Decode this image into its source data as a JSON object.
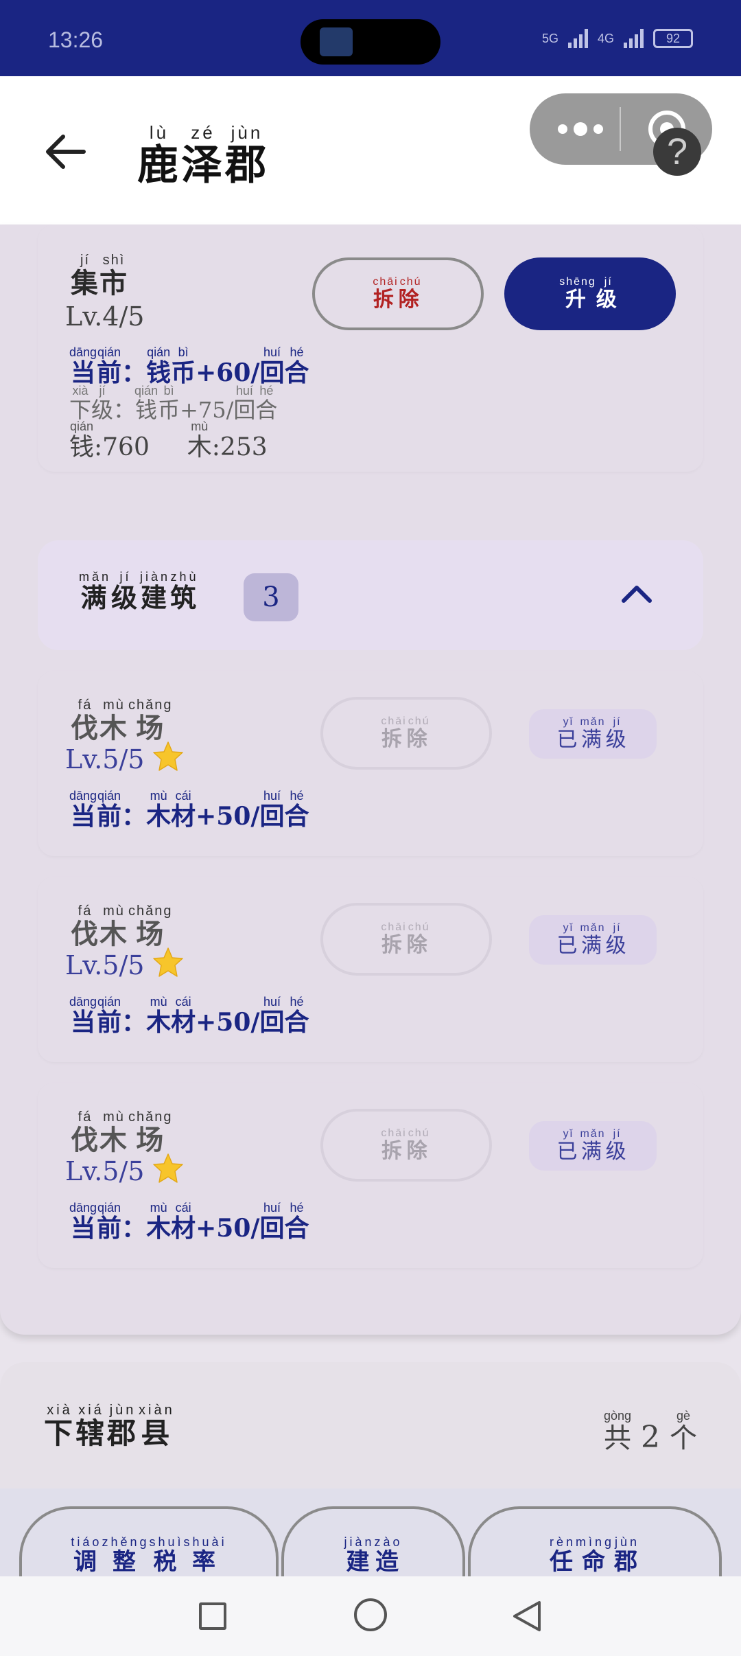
{
  "status": {
    "time": "13:26",
    "net1": "5G",
    "net2": "4G",
    "battery": "92"
  },
  "header": {
    "title": [
      {
        "ch": "鹿",
        "py": "lù"
      },
      {
        "ch": "泽",
        "py": "zé"
      },
      {
        "ch": "郡",
        "py": "jùn"
      }
    ],
    "help": "?"
  },
  "market": {
    "name": [
      {
        "ch": "集",
        "py": "jí"
      },
      {
        "ch": "市",
        "py": "shì"
      }
    ],
    "level": "Lv.4/5",
    "demolish": [
      {
        "ch": "拆",
        "py": "chāi"
      },
      {
        "ch": "除",
        "py": "chú"
      }
    ],
    "upgrade": [
      {
        "ch": "升",
        "py": "shēng"
      },
      {
        "ch": "级",
        "py": "jí"
      }
    ],
    "current": {
      "label": [
        {
          "ch": "当",
          "py": "dāng"
        },
        {
          "ch": "前",
          "py": "qián"
        }
      ],
      "colon": "：",
      "res": [
        {
          "ch": "钱",
          "py": "qián"
        },
        {
          "ch": "币",
          "py": "bì"
        }
      ],
      "amount": "+60/",
      "unit": [
        {
          "ch": "回",
          "py": "huí"
        },
        {
          "ch": "合",
          "py": "hé"
        }
      ]
    },
    "next": {
      "label": [
        {
          "ch": "下",
          "py": "xià"
        },
        {
          "ch": "级",
          "py": "jí"
        }
      ],
      "colon": "：",
      "res": [
        {
          "ch": "钱",
          "py": "qián"
        },
        {
          "ch": "币",
          "py": "bì"
        }
      ],
      "amount": "+75/",
      "unit": [
        {
          "ch": "回",
          "py": "huí"
        },
        {
          "ch": "合",
          "py": "hé"
        }
      ]
    },
    "cost": {
      "money_ch": "钱",
      "money_py": "qián",
      "money_val": ":760",
      "wood_ch": "木",
      "wood_py": "mù",
      "wood_val": ":253"
    }
  },
  "maxed_section": {
    "title": [
      {
        "ch": "满",
        "py": "mǎn"
      },
      {
        "ch": "级",
        "py": "jí"
      },
      {
        "ch": "建",
        "py": "jiàn"
      },
      {
        "ch": "筑",
        "py": "zhù"
      }
    ],
    "count": "3",
    "buildings": [
      {
        "name": [
          {
            "ch": "伐",
            "py": "fá"
          },
          {
            "ch": "木",
            "py": "mù"
          },
          {
            "ch": "场",
            "py": "chǎng"
          }
        ],
        "level": "Lv.5/5",
        "current": {
          "label": [
            {
              "ch": "当",
              "py": "dāng"
            },
            {
              "ch": "前",
              "py": "qián"
            }
          ],
          "colon": "：",
          "res": [
            {
              "ch": "木",
              "py": "mù"
            },
            {
              "ch": "材",
              "py": "cái"
            }
          ],
          "amount": "+50/",
          "unit": [
            {
              "ch": "回",
              "py": "huí"
            },
            {
              "ch": "合",
              "py": "hé"
            }
          ]
        }
      },
      {
        "name": [
          {
            "ch": "伐",
            "py": "fá"
          },
          {
            "ch": "木",
            "py": "mù"
          },
          {
            "ch": "场",
            "py": "chǎng"
          }
        ],
        "level": "Lv.5/5",
        "current": {
          "label": [
            {
              "ch": "当",
              "py": "dāng"
            },
            {
              "ch": "前",
              "py": "qián"
            }
          ],
          "colon": "：",
          "res": [
            {
              "ch": "木",
              "py": "mù"
            },
            {
              "ch": "材",
              "py": "cái"
            }
          ],
          "amount": "+50/",
          "unit": [
            {
              "ch": "回",
              "py": "huí"
            },
            {
              "ch": "合",
              "py": "hé"
            }
          ]
        }
      },
      {
        "name": [
          {
            "ch": "伐",
            "py": "fá"
          },
          {
            "ch": "木",
            "py": "mù"
          },
          {
            "ch": "场",
            "py": "chǎng"
          }
        ],
        "level": "Lv.5/5",
        "current": {
          "label": [
            {
              "ch": "当",
              "py": "dāng"
            },
            {
              "ch": "前",
              "py": "qián"
            }
          ],
          "colon": "：",
          "res": [
            {
              "ch": "木",
              "py": "mù"
            },
            {
              "ch": "材",
              "py": "cái"
            }
          ],
          "amount": "+50/",
          "unit": [
            {
              "ch": "回",
              "py": "huí"
            },
            {
              "ch": "合",
              "py": "hé"
            }
          ]
        }
      }
    ],
    "demolish": [
      {
        "ch": "拆",
        "py": "chāi"
      },
      {
        "ch": "除",
        "py": "chú"
      }
    ],
    "maxed": [
      {
        "ch": "已",
        "py": "yǐ"
      },
      {
        "ch": "满",
        "py": "mǎn"
      },
      {
        "ch": "级",
        "py": "jí"
      }
    ]
  },
  "county": {
    "title": [
      {
        "ch": "下",
        "py": "xià"
      },
      {
        "ch": "辖",
        "py": "xiá"
      },
      {
        "ch": "郡",
        "py": "jùn"
      },
      {
        "ch": "县",
        "py": "xiàn"
      }
    ],
    "count_pre": {
      "ch": "共",
      "py": "gòng"
    },
    "count": "2",
    "count_post": {
      "ch": "个",
      "py": "gè"
    },
    "actions": [
      [
        {
          "ch": "调",
          "py": "tiáo"
        },
        {
          "ch": "整",
          "py": "zhěng"
        },
        {
          "ch": "税",
          "py": "shuì"
        },
        {
          "ch": "率",
          "py": "shuài"
        }
      ],
      [
        {
          "ch": "建",
          "py": "jiàn"
        },
        {
          "ch": "造",
          "py": "zào"
        }
      ],
      [
        {
          "ch": "任",
          "py": "rèn"
        },
        {
          "ch": "命",
          "py": "mìng"
        },
        {
          "ch": "郡",
          "py": "jùn"
        }
      ]
    ]
  },
  "colors": {
    "primary": "#1a2583",
    "danger": "#b22222",
    "panel": "#e4dde8"
  }
}
